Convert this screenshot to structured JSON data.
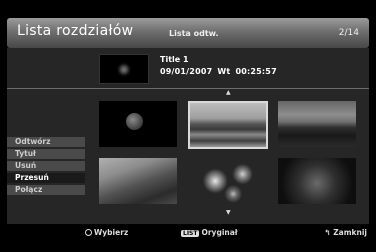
{
  "header": {
    "title": "Lista rozdziałów",
    "subtitle": "Lista odtw.",
    "counter": "2/14"
  },
  "info": {
    "title": "Title 1",
    "date": "09/01/2007",
    "weekday": "Wt",
    "time": "00:25:57"
  },
  "arrows": {
    "up": "▲",
    "down": "▼"
  },
  "menu": {
    "items": [
      {
        "label": "Odtwórz"
      },
      {
        "label": "Tytuł"
      },
      {
        "label": "Usuń"
      },
      {
        "label": "Przesuń"
      },
      {
        "label": "Połącz"
      }
    ]
  },
  "footer": {
    "select_label": "Wybierz",
    "list_badge": "LIST",
    "original_label": "Oryginał",
    "return_icon": "↰",
    "close_label": "Zamknij"
  }
}
